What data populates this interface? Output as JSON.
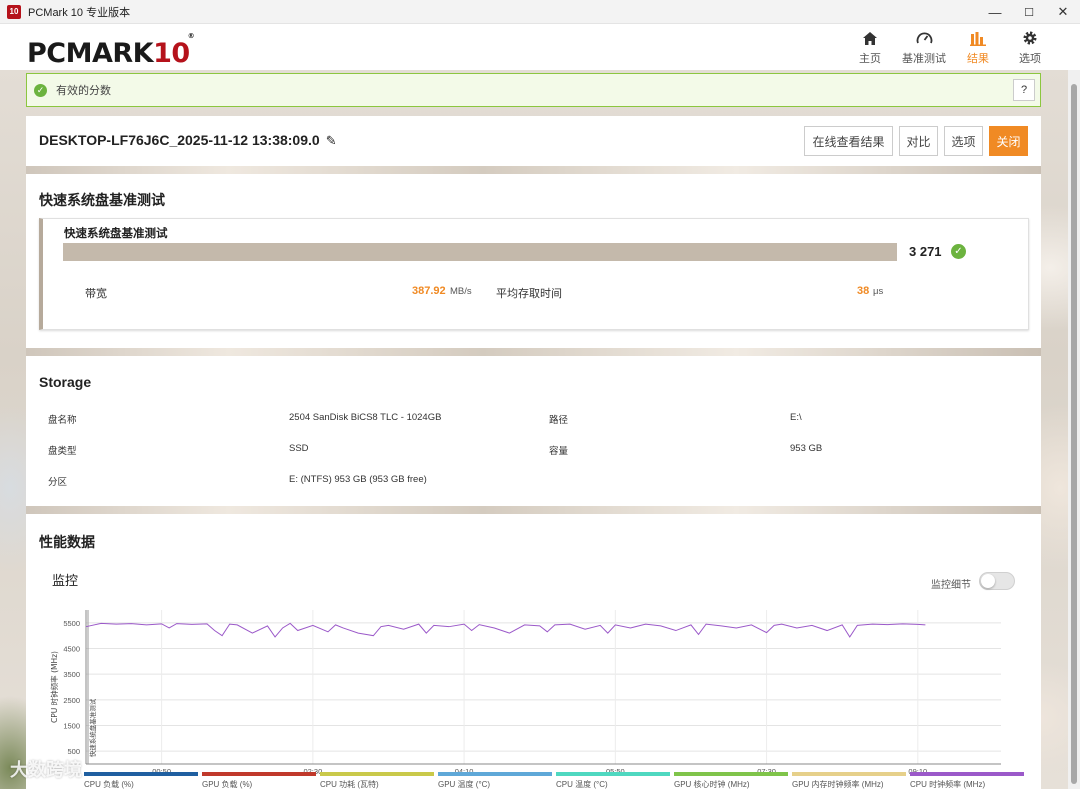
{
  "window": {
    "title": "PCMark 10 专业版本",
    "icon_text": "10",
    "minimize": "—",
    "maximize": "☐",
    "close": "✕"
  },
  "logo": {
    "main": "PCMARK",
    "num": "10",
    "reg": "®"
  },
  "nav": [
    {
      "label": "主页",
      "icon": "home-icon"
    },
    {
      "label": "基准测试",
      "icon": "gauge-icon"
    },
    {
      "label": "结果",
      "icon": "bar-chart-icon",
      "active": true
    },
    {
      "label": "选项",
      "icon": "gear-icon"
    }
  ],
  "banner": {
    "text": "有效的分数",
    "help": "?"
  },
  "result": {
    "title": "DESKTOP-LF76J6C_2025-11-12 13:38:09.0",
    "buttons": {
      "online": "在线查看结果",
      "compare": "对比",
      "options": "选项",
      "close": "关闭"
    }
  },
  "benchmark": {
    "section_title": "快速系统盘基准测试",
    "card_title": "快速系统盘基准测试",
    "score": "3 271",
    "bandwidth_label": "带宽",
    "bandwidth_value": "387.92",
    "bandwidth_unit": "MB/s",
    "access_label": "平均存取时间",
    "access_value": "38",
    "access_unit": "μs"
  },
  "storage": {
    "section_title": "Storage",
    "rows": [
      {
        "k1": "盘名称",
        "v1": "2504 SanDisk BiCS8 TLC - 1024GB",
        "k2": "路径",
        "v2": "E:\\"
      },
      {
        "k1": "盘类型",
        "v1": "SSD",
        "k2": "容量",
        "v2": "953 GB"
      },
      {
        "k1": "分区",
        "v1": "E: (NTFS) 953 GB (953 GB free)",
        "k2": "",
        "v2": ""
      }
    ]
  },
  "performance": {
    "section_title": "性能数据",
    "monitor_title": "监控",
    "toggle_label": "监控细节",
    "toggle_on": false
  },
  "chart_data": {
    "type": "line",
    "ylabel": "CPU 时钟频率 (MHz)",
    "marker_label": "快速系统盘基准测试",
    "yticks": [
      5500,
      4500,
      3500,
      2500,
      1500,
      500
    ],
    "ylim": [
      0,
      6000
    ],
    "xticks": [
      "00:50",
      "02:30",
      "04:10",
      "05:50",
      "07:30",
      "09:10"
    ],
    "xtick_seconds": [
      50,
      150,
      250,
      350,
      450,
      550
    ],
    "xlim": [
      0,
      605
    ],
    "series": [
      {
        "color": "#9b59c9",
        "x": [
          0,
          10,
          20,
          30,
          40,
          50,
          55,
          60,
          70,
          80,
          85,
          90,
          95,
          100,
          110,
          120,
          125,
          130,
          135,
          140,
          150,
          160,
          165,
          170,
          180,
          190,
          195,
          200,
          210,
          220,
          225,
          230,
          240,
          250,
          255,
          260,
          270,
          280,
          290,
          300,
          305,
          310,
          320,
          330,
          340,
          345,
          350,
          360,
          370,
          380,
          390,
          400,
          405,
          410,
          420,
          430,
          440,
          450,
          455,
          460,
          470,
          480,
          490,
          500,
          505,
          510,
          520,
          530,
          540,
          550,
          555
        ],
        "values": [
          5350,
          5480,
          5450,
          5470,
          5420,
          5460,
          5300,
          5470,
          5440,
          5460,
          5200,
          5000,
          5450,
          5420,
          5100,
          5380,
          4950,
          5300,
          5480,
          5200,
          5400,
          5150,
          5420,
          5300,
          5100,
          5000,
          5350,
          5400,
          5250,
          5450,
          5100,
          5400,
          5350,
          5450,
          5200,
          5430,
          5300,
          5100,
          5420,
          5380,
          5150,
          5420,
          5450,
          5250,
          5400,
          5100,
          5420,
          5300,
          5450,
          5380,
          5200,
          5420,
          5050,
          5450,
          5380,
          5300,
          5420,
          5120,
          5400,
          5450,
          5300,
          5400,
          5200,
          5420,
          4950,
          5400,
          5450,
          5430,
          5460,
          5440,
          5420
        ]
      }
    ],
    "legend": [
      {
        "name": "CPU 负载 (%)",
        "color": "#1f5fa0"
      },
      {
        "name": "GPU 负载 (%)",
        "color": "#c0392b"
      },
      {
        "name": "CPU 功耗 (瓦特)",
        "color": "#c9c94a"
      },
      {
        "name": "GPU 温度 (°C)",
        "color": "#5fa8d8"
      },
      {
        "name": "CPU 温度 (°C)",
        "color": "#4fd8c0"
      },
      {
        "name": "GPU 核心时钟 (MHz)",
        "color": "#7fc44a"
      },
      {
        "name": "GPU 内存时钟频率 (MHz)",
        "color": "#e6d08a"
      },
      {
        "name": "CPU 时钟频率 (MHz)",
        "color": "#9b59c9"
      }
    ]
  },
  "watermark": "大数跨境"
}
